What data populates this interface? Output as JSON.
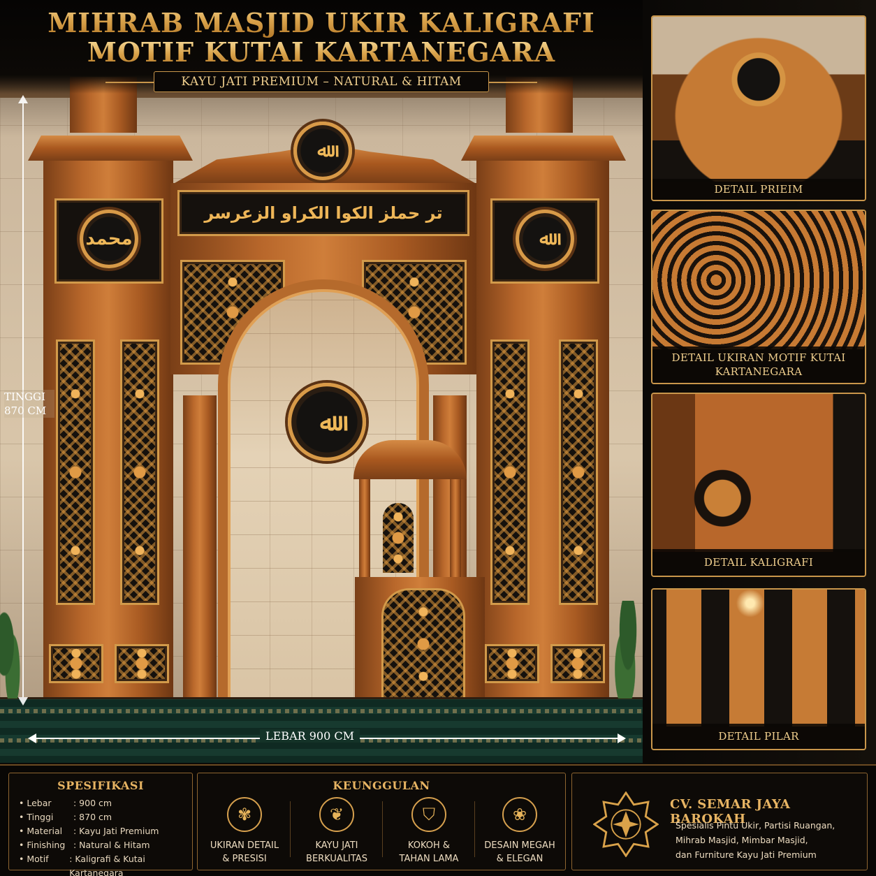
{
  "header": {
    "title_line1": "MIHRAB MASJID UKIR KALIGRAFI",
    "title_line2": "MOTIF KUTAI KARTANEGARA",
    "subtitle": "KAYU JATI PREMIUM – NATURAL & HITAM"
  },
  "dimensions": {
    "height_label": "TINGGI\n870 CM",
    "width_label": "LEBAR 900 CM"
  },
  "calligraphy": {
    "allah": "ﷲ",
    "muhammad": "محمد",
    "top_band": "تر حملز الكوا الكراو الزعرسر"
  },
  "details": [
    {
      "caption": "DETAIL PRIEIM",
      "icon": "crown-carving"
    },
    {
      "caption": "DETAIL UKIRAN MOTIF KUTAI KARTANEGARA",
      "icon": "scroll-carving"
    },
    {
      "caption": "DETAIL KALIGRAFI",
      "icon": "pillar-panel"
    },
    {
      "caption": "DETAIL PILAR",
      "icon": "capital-carving"
    }
  ],
  "spesifikasi": {
    "heading": "SPESIFIKASI",
    "rows": [
      {
        "key": "Lebar",
        "value": ": 900 cm"
      },
      {
        "key": "Tinggi",
        "value": ": 870 cm"
      },
      {
        "key": "Material",
        "value": ": Kayu Jati Premium"
      },
      {
        "key": "Finishing",
        "value": ": Natural & Hitam"
      },
      {
        "key": "Motif",
        "value": ": Kaligrafi & Kutai Kartanegara"
      }
    ]
  },
  "keunggulan": {
    "heading": "KEUNGGULAN",
    "items": [
      {
        "label_1": "UKIRAN DETAIL",
        "label_2": "& PRESISI",
        "icon": "flower-icon"
      },
      {
        "label_1": "KAYU JATI",
        "label_2": "BERKUALITAS",
        "icon": "leaf-icon"
      },
      {
        "label_1": "KOKOH &",
        "label_2": "TAHAN LAMA",
        "icon": "shield-icon"
      },
      {
        "label_1": "DESAIN MEGAH",
        "label_2": "& ELEGAN",
        "icon": "lotus-icon"
      }
    ]
  },
  "company": {
    "name": "CV. SEMAR JAYA BAROKAH",
    "desc_1": "Spesialis Pintu Ukir, Partisi Ruangan,",
    "desc_2": "Mihrab Masjid, Mimbar Masjid,",
    "desc_3": "dan Furniture Kayu Jati Premium",
    "logo_icon": "ornament-star-logo"
  },
  "colors": {
    "gold": "#e6b75f",
    "teak": "#b8672b",
    "black": "#15110d",
    "carpet": "#133328"
  }
}
